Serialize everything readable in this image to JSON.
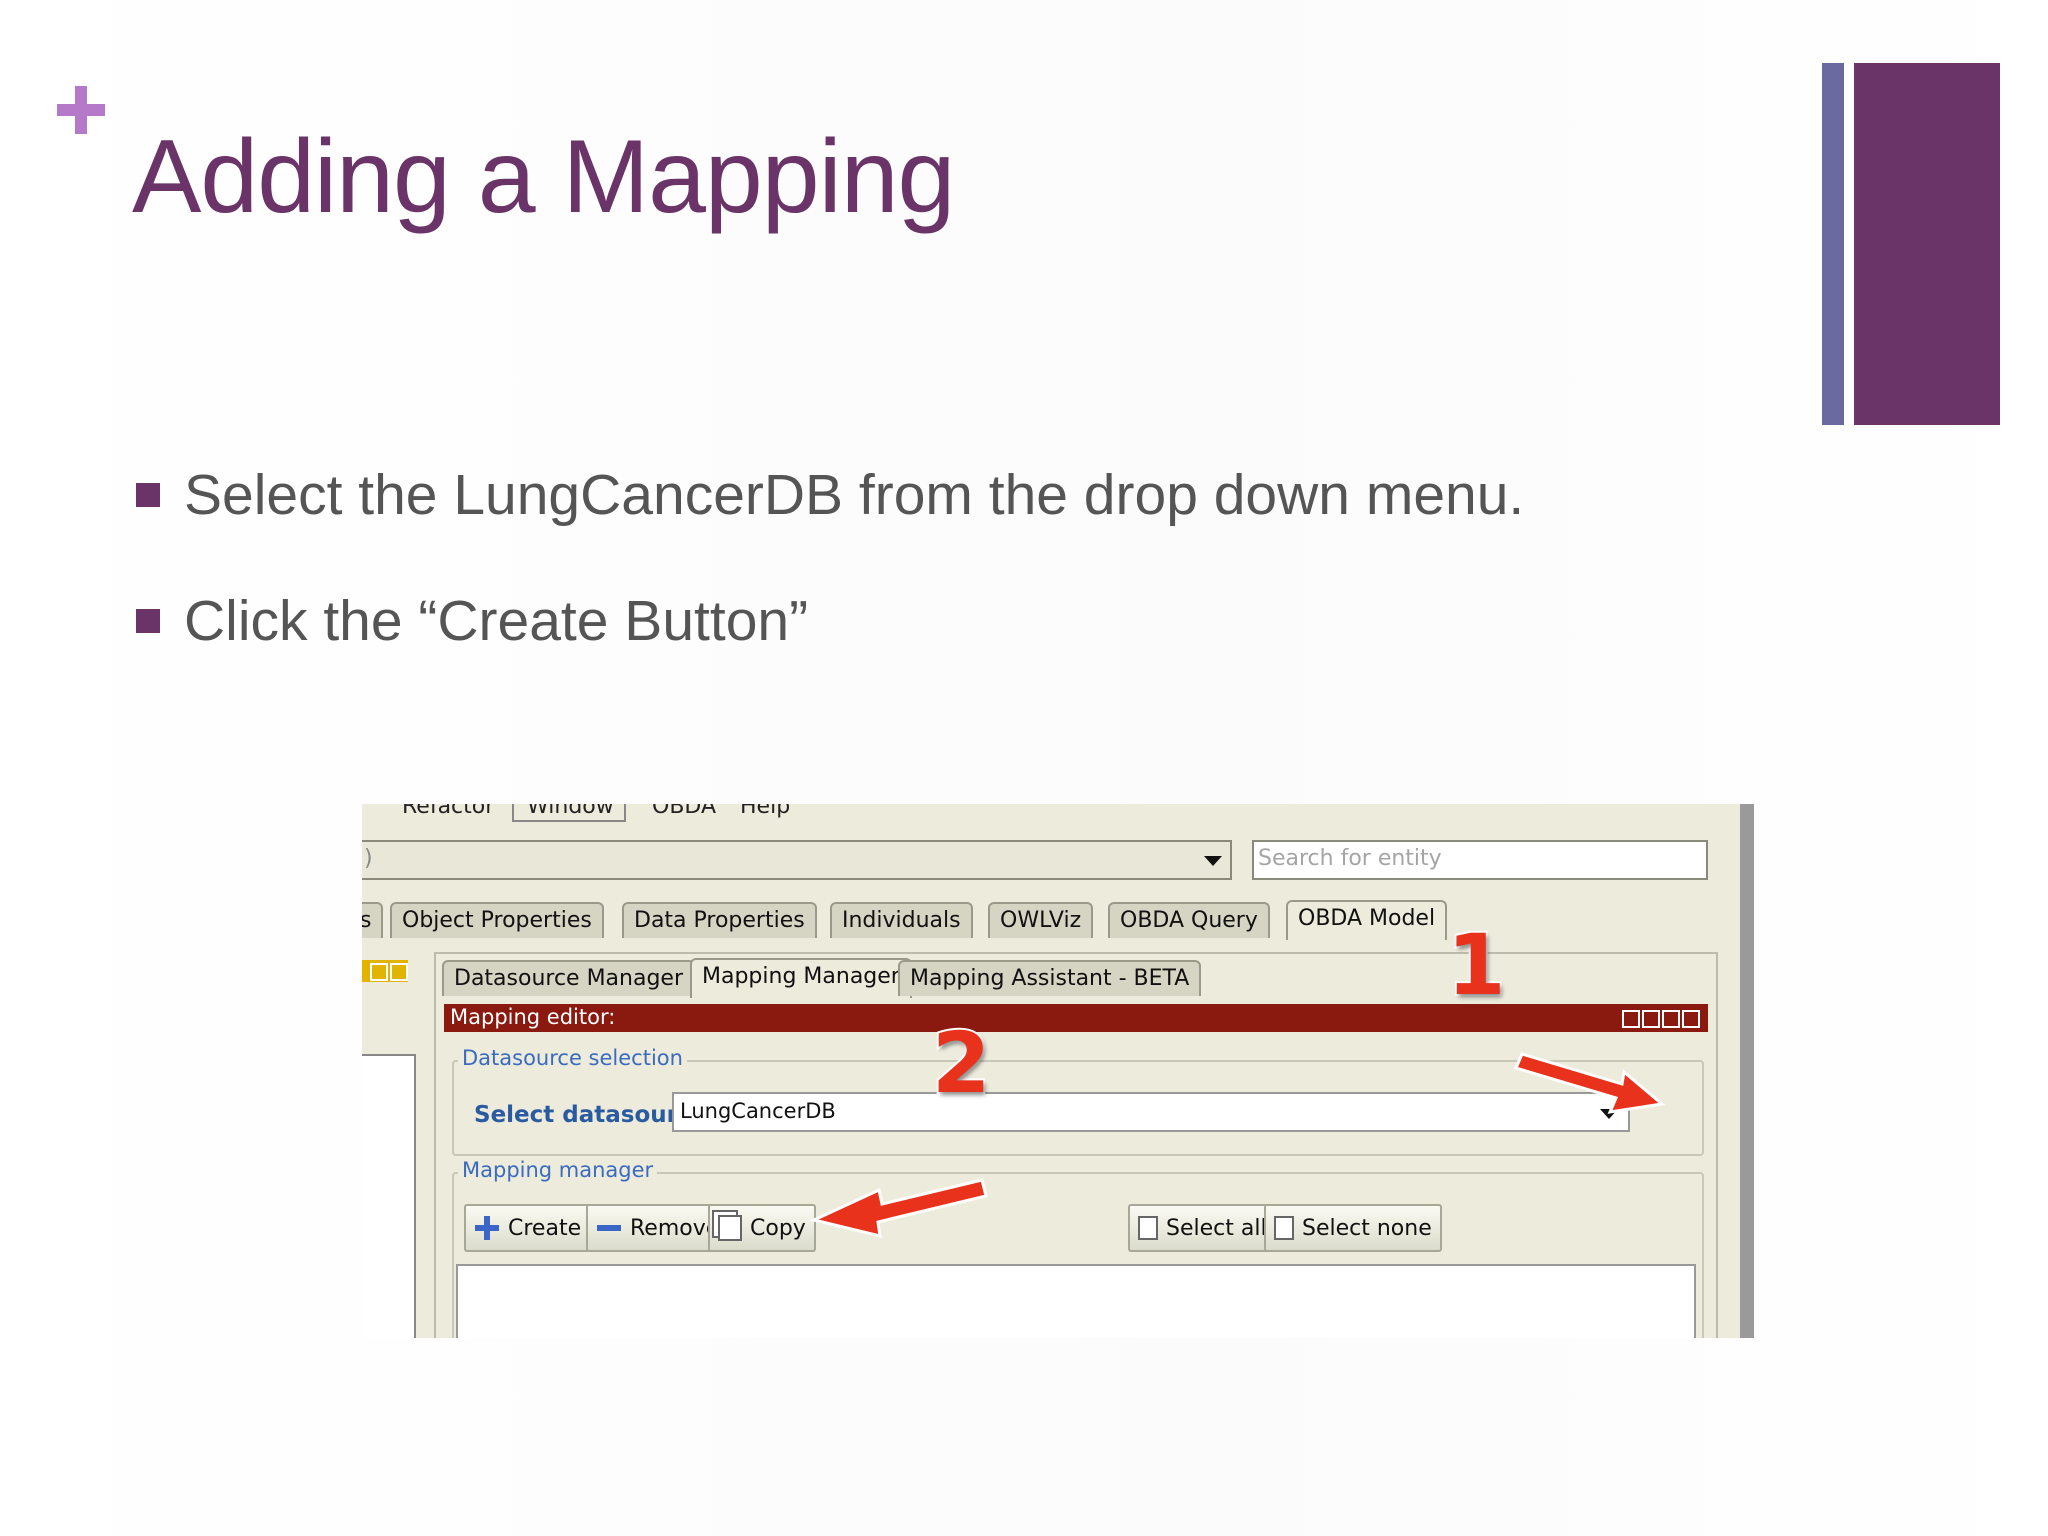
{
  "slide": {
    "title": "Adding a Mapping",
    "bullets": [
      "Select the LungCancerDB from the drop down menu.",
      "Click the “Create Button”"
    ],
    "accent": "#6a3468",
    "plus_color": "#b678c9"
  },
  "screenshot": {
    "menu_partial": [
      "Refactor",
      "Window",
      "OBDA",
      "Help"
    ],
    "ontology_combo_partial": ")",
    "search_placeholder": "Search for entity",
    "main_tabs": [
      {
        "label": "s",
        "active": false
      },
      {
        "label": "Object Properties",
        "active": false
      },
      {
        "label": "Data Properties",
        "active": false
      },
      {
        "label": "Individuals",
        "active": false
      },
      {
        "label": "OWLViz",
        "active": false
      },
      {
        "label": "OBDA Query",
        "active": false
      },
      {
        "label": "OBDA Model",
        "active": true
      }
    ],
    "sub_tabs": [
      {
        "label": "Datasource Manager",
        "active": false
      },
      {
        "label": "Mapping Manager",
        "active": true
      },
      {
        "label": "Mapping Assistant - BETA",
        "active": false
      }
    ],
    "editor_title": "Mapping editor:",
    "datasource_group": "Datasource selection",
    "select_label": "Select datasource:",
    "select_value": "LungCancerDB",
    "mapping_group": "Mapping manager",
    "buttons": {
      "create": "Create",
      "remove": "Remove",
      "copy": "Copy",
      "select_all": "Select all",
      "select_none": "Select none"
    },
    "annotations": [
      "1",
      "2"
    ],
    "editor_bar_color": "#8a1a10",
    "annotation_color": "#e8321c"
  }
}
